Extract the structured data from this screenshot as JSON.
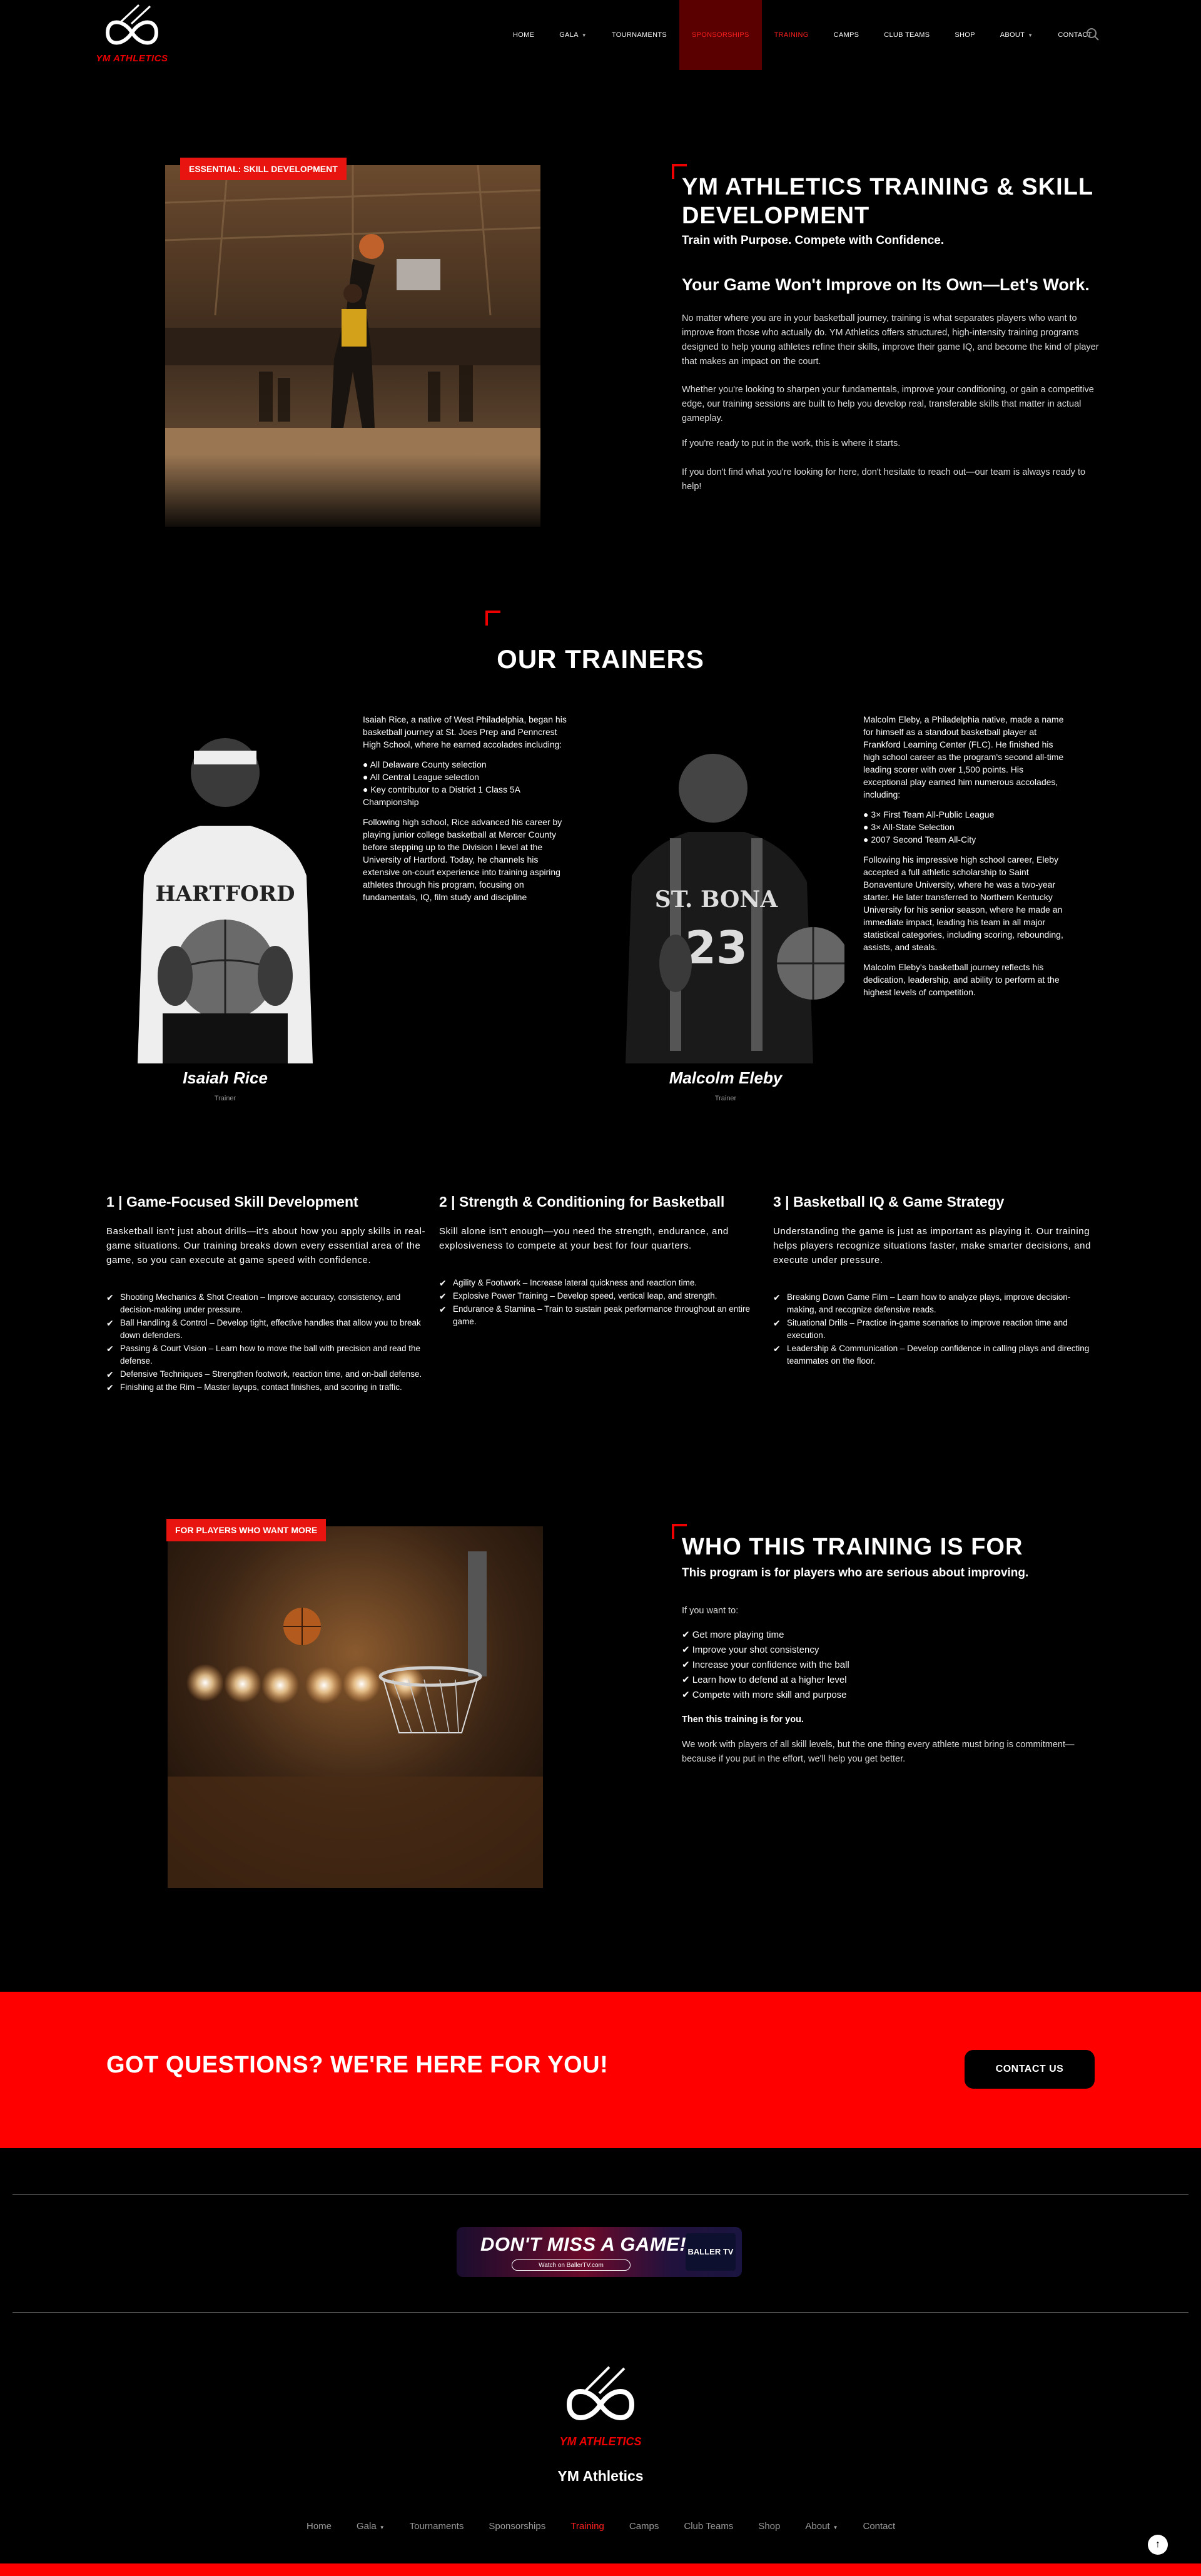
{
  "colors": {
    "accent": "#ff0000",
    "tag": "#e8140f",
    "background": "#000000"
  },
  "header": {
    "logo_text": "YM ATHLETICS",
    "nav": [
      {
        "label": "HOME"
      },
      {
        "label": "GALA"
      },
      {
        "label": "TOURNAMENTS"
      },
      {
        "label": "SPONSORSHIPS"
      },
      {
        "label": "TRAINING"
      },
      {
        "label": "CAMPS"
      },
      {
        "label": "CLUB TEAMS"
      },
      {
        "label": "SHOP"
      },
      {
        "label": "ABOUT"
      },
      {
        "label": "CONTACT"
      }
    ]
  },
  "intro": {
    "tag": "ESSENTIAL: SKILL DEVELOPMENT",
    "title": "YM ATHLETICS TRAINING & SKILL DEVELOPMENT",
    "subtitle": "Train with Purpose. Compete with Confidence.",
    "heading": "Your Game Won't Improve on Its Own—Let's Work.",
    "p1": "No matter where you are in your basketball journey, training is what separates players who want to improve from those who actually do. YM Athletics offers structured, high-intensity training programs designed to help young athletes refine their skills, improve their game IQ, and become the kind of player that makes an impact on the court.",
    "p2": "Whether you're looking to sharpen your fundamentals, improve your conditioning, or gain a competitive edge, our training sessions are built to help you develop real, transferable skills that matter in actual gameplay.",
    "p3": "If you're ready to put in the work, this is where it starts.",
    "p4": "If you don't find what you're looking for here, don't hesitate to reach out—our team is always ready to help!"
  },
  "trainers": {
    "title": "OUR TRAINERS",
    "list": [
      {
        "name": "Isaiah Rice",
        "role": "Trainer",
        "bio1": "Isaiah Rice, a native of West Philadelphia, began his basketball journey at St. Joes Prep and Penncrest High School, where he earned accolades including:",
        "bullets": [
          "● All Delaware County selection",
          "● All Central League selection",
          "● Key contributor to a District 1 Class 5A Championship"
        ],
        "bio2": "Following high school, Rice advanced his career by playing junior college basketball at Mercer County before stepping up to the Division I level at the University of Hartford. Today, he channels his extensive on-court experience into training aspiring athletes through his program, focusing on fundamentals, IQ, film study and discipline"
      },
      {
        "name": "Malcolm Eleby",
        "role": "Trainer",
        "bio1": "Malcolm Eleby, a Philadelphia native, made a name for himself as a standout basketball player at Frankford Learning Center (FLC). He finished his high school career as the program's second all-time leading scorer with over 1,500 points. His exceptional play earned him numerous accolades, including:",
        "bullets": [
          "● 3× First Team All-Public League",
          "● 3× All-State Selection",
          "● 2007 Second Team All-City"
        ],
        "bio2": "Following his impressive high school career, Eleby accepted a full athletic scholarship to Saint Bonaventure University, where he was a two-year starter. He later transferred to Northern Kentucky University for his senior season, where he made an immediate impact, leading his team in all major statistical categories, including scoring, rebounding, assists, and steals.",
        "bio3": "Malcolm Eleby's basketball journey reflects his dedication, leadership, and ability to perform at the highest levels of competition."
      }
    ]
  },
  "programs": [
    {
      "title": "1 | Game-Focused Skill Development",
      "intro": "Basketball isn't just about drills—it's about how you apply skills in real-game situations. Our training breaks down every essential area of the game, so you can execute at game speed with confidence.",
      "items": [
        "Shooting Mechanics & Shot Creation – Improve accuracy, consistency, and decision-making under pressure.",
        "Ball Handling & Control – Develop tight, effective handles that allow you to break down defenders.",
        "Passing & Court Vision – Learn how to move the ball with precision and read the defense.",
        "Defensive Techniques – Strengthen footwork, reaction time, and on-ball defense.",
        "Finishing at the Rim – Master layups, contact finishes, and scoring in traffic."
      ]
    },
    {
      "title": "2 | Strength & Conditioning for Basketball",
      "intro": "Skill alone isn't enough—you need the strength, endurance, and explosiveness to compete at your best for four quarters.",
      "items": [
        "Agility & Footwork – Increase lateral quickness and reaction time.",
        "Explosive Power Training – Develop speed, vertical leap, and strength.",
        "Endurance & Stamina – Train to sustain peak performance throughout an entire game."
      ]
    },
    {
      "title": "3 | Basketball IQ & Game Strategy",
      "intro": "Understanding the game is just as important as playing it. Our training helps players recognize situations faster, make smarter decisions, and execute under pressure.",
      "items": [
        "Breaking Down Game Film – Learn how to analyze plays, improve decision-making, and recognize defensive reads.",
        "Situational Drills – Practice in-game scenarios to improve reaction time and execution.",
        "Leadership & Communication – Develop confidence in calling plays and directing teammates on the floor."
      ]
    }
  ],
  "who": {
    "tag": "FOR PLAYERS WHO WANT MORE",
    "title": "WHO THIS TRAINING IS FOR",
    "subtitle": "This program is for players who are serious about improving.",
    "lead": "If you want to:",
    "items": [
      "✔ Get more playing time",
      "✔ Improve your shot consistency",
      "✔ Increase your confidence with the ball",
      "✔ Learn how to defend at a higher level",
      "✔ Compete with more skill and purpose"
    ],
    "then": "Then this training is for you.",
    "closing": "We work with players of all skill levels, but the one thing every athlete must bring is commitment—because if you put in the effort, we'll help you get better."
  },
  "cta": {
    "title": "GOT QUESTIONS? WE'RE HERE FOR YOU!",
    "button": "CONTACT US"
  },
  "banner": {
    "title": "DON'T MISS A GAME!",
    "sub": "Watch on BallerTV.com",
    "brand": "BALLER TV"
  },
  "footer": {
    "brand": "YM Athletics",
    "logo_text": "YM ATHLETICS",
    "nav": [
      "Home",
      "Gala",
      "Tournaments",
      "Sponsorships",
      "Training",
      "Camps",
      "Club Teams",
      "Shop",
      "About",
      "Contact"
    ],
    "to_top": "↑"
  }
}
